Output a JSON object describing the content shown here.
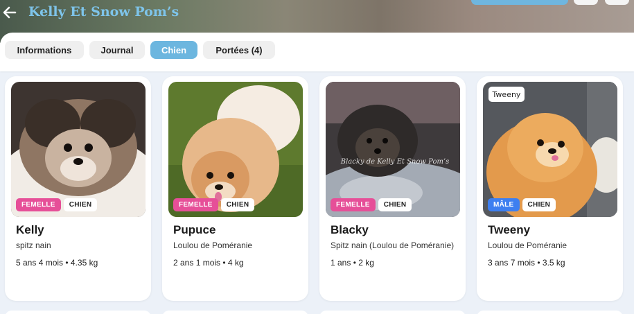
{
  "header": {
    "title": "Kelly Et Snow Pom’s",
    "back_icon": "arrow-left-icon"
  },
  "tabs": [
    {
      "label": "Informations",
      "active": false
    },
    {
      "label": "Journal",
      "active": false
    },
    {
      "label": "Chien",
      "active": true
    },
    {
      "label": "Portées (4)",
      "active": false
    }
  ],
  "colors": {
    "accent": "#6cb6df",
    "female_badge": "#e64f98",
    "male_badge": "#3d7ff0",
    "title": "#7ec4ea"
  },
  "dogs": [
    {
      "name": "Kelly",
      "breed": "spitz nain",
      "sex": "FEMELLE",
      "kind": "CHIEN",
      "stats": "5 ans 4 mois • 4.35 kg"
    },
    {
      "name": "Pupuce",
      "breed": "Loulou de Poméranie",
      "sex": "FEMELLE",
      "kind": "CHIEN",
      "stats": "2 ans 1 mois • 4 kg"
    },
    {
      "name": "Blacky",
      "breed": "Spitz nain (Loulou de Poméranie)",
      "sex": "FEMELLE",
      "kind": "CHIEN",
      "stats": "1 ans • 2 kg",
      "photo_caption": "Blacky de Kelly Et Snow Pom’s"
    },
    {
      "name": "Tweeny",
      "breed": "Loulou de Poméranie",
      "sex": "MÂLE",
      "kind": "CHIEN",
      "stats": "3 ans 7 mois • 3.5 kg",
      "photo_caption": "Tweeny"
    }
  ]
}
